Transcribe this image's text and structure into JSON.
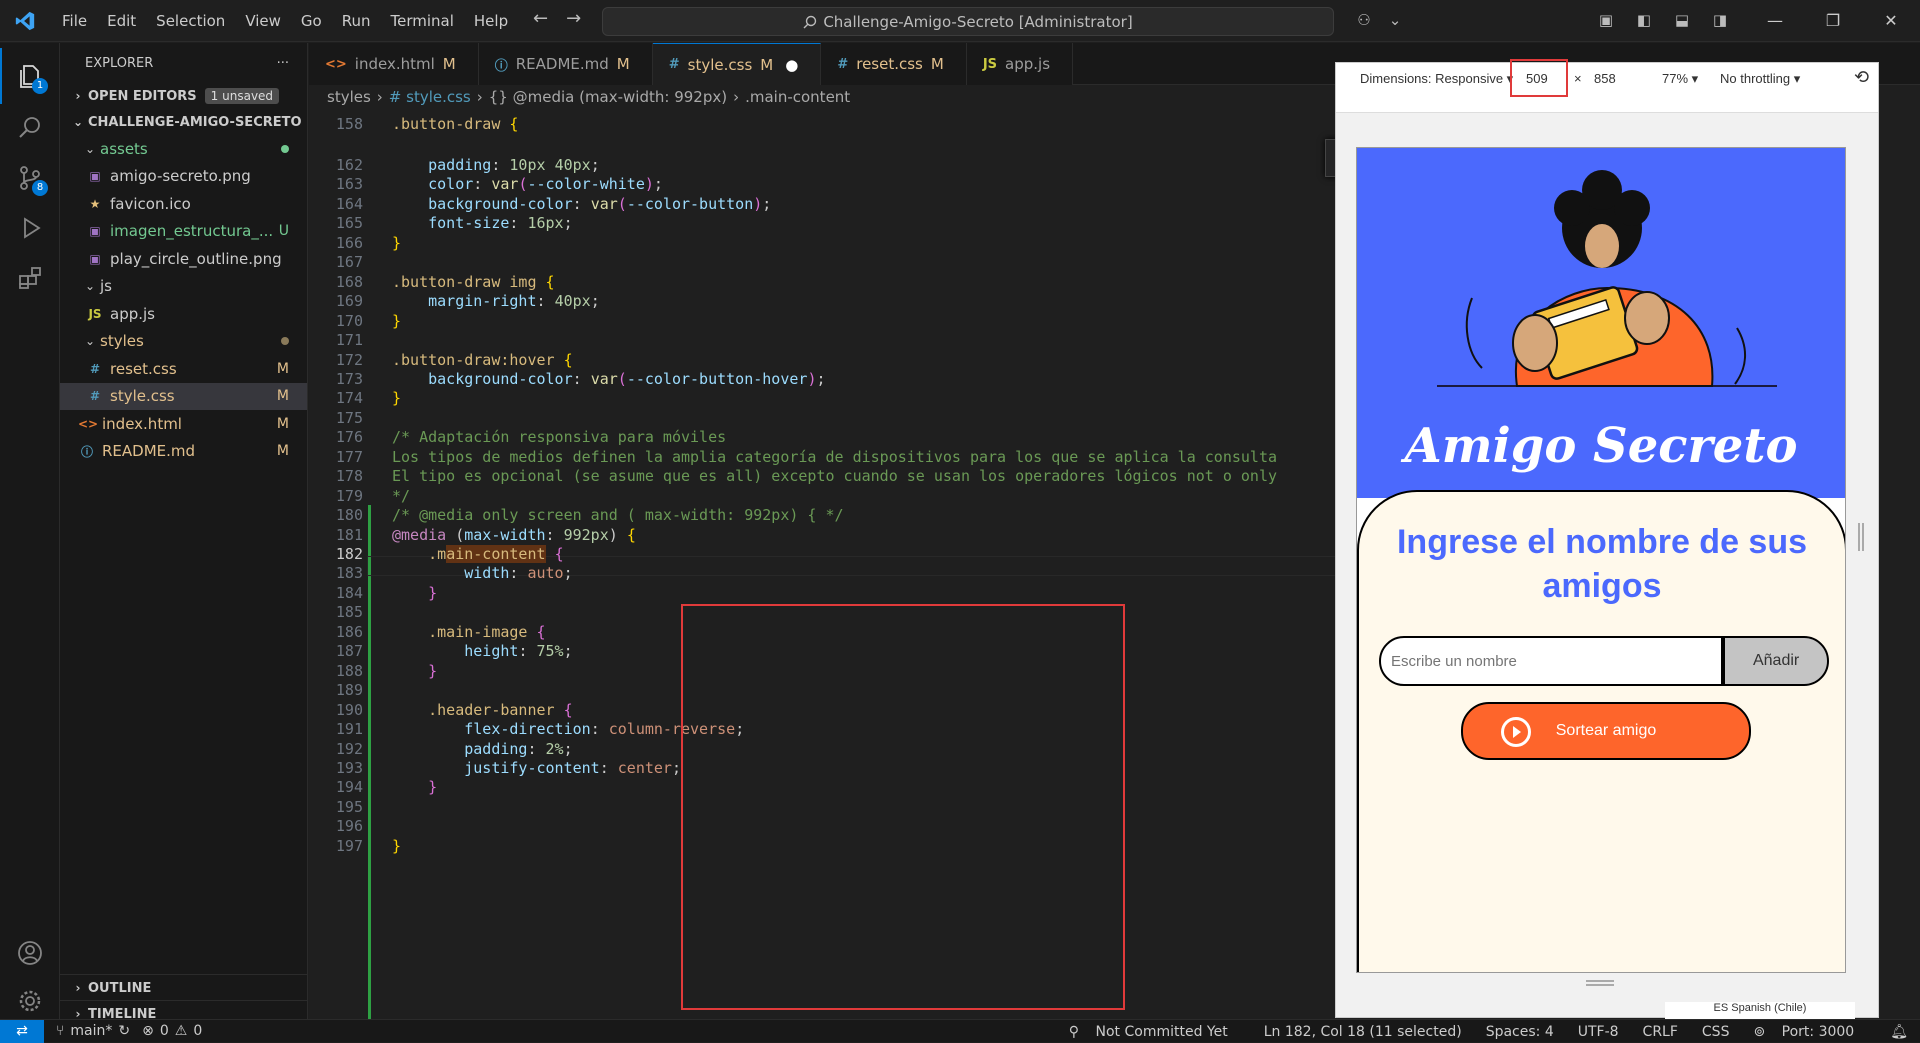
{
  "window": {
    "title": "Challenge-Amigo-Secreto [Administrator]"
  },
  "menu": [
    "File",
    "Edit",
    "Selection",
    "View",
    "Go",
    "Run",
    "Terminal",
    "Help"
  ],
  "activity": {
    "explorer_badge": "1",
    "scm_badge": "8"
  },
  "explorer": {
    "title": "EXPLORER",
    "open_editors": "OPEN EDITORS",
    "unsaved": "1 unsaved",
    "project": "CHALLENGE-AMIGO-SECRETO",
    "items": [
      {
        "name": "assets",
        "status": "",
        "indent": 1,
        "type": "folder"
      },
      {
        "name": "amigo-secreto.png",
        "status": "",
        "indent": 2,
        "type": "img"
      },
      {
        "name": "favicon.ico",
        "status": "",
        "indent": 2,
        "type": "star"
      },
      {
        "name": "imagen_estructura_...",
        "status": "U",
        "indent": 2,
        "type": "img"
      },
      {
        "name": "play_circle_outline.png",
        "status": "",
        "indent": 2,
        "type": "img"
      },
      {
        "name": "js",
        "status": "",
        "indent": 1,
        "type": "folder"
      },
      {
        "name": "app.js",
        "status": "",
        "indent": 2,
        "type": "js"
      },
      {
        "name": "styles",
        "status": "",
        "indent": 1,
        "type": "folder"
      },
      {
        "name": "reset.css",
        "status": "M",
        "indent": 2,
        "type": "css"
      },
      {
        "name": "style.css",
        "status": "M",
        "indent": 2,
        "type": "css"
      },
      {
        "name": "index.html",
        "status": "M",
        "indent": 1,
        "type": "html"
      },
      {
        "name": "README.md",
        "status": "M",
        "indent": 1,
        "type": "info"
      }
    ],
    "outline": "OUTLINE",
    "timeline": "TIMELINE"
  },
  "tabs": [
    {
      "icon": "<>",
      "label": "index.html",
      "mark": "M"
    },
    {
      "icon": "ⓘ",
      "label": "README.md",
      "mark": "M"
    },
    {
      "icon": "#",
      "label": "style.css",
      "mark": "M",
      "active": true
    },
    {
      "icon": "#",
      "label": "reset.css",
      "mark": "M"
    },
    {
      "icon": "JS",
      "label": "app.js",
      "mark": ""
    }
  ],
  "breadcrumbs": [
    "styles",
    "# style.css",
    "{} @media (max-width: 992px)",
    ".main-content"
  ],
  "find_widget": "ain-cont",
  "code": {
    "sticky": {
      "n": "158",
      "text": ".button-draw {"
    },
    "lines": [
      {
        "n": "162",
        "t": "    padding: 10px 40px;"
      },
      {
        "n": "163",
        "t": "    color: var(--color-white);"
      },
      {
        "n": "164",
        "t": "    background-color: var(--color-button);"
      },
      {
        "n": "165",
        "t": "    font-size: 16px;"
      },
      {
        "n": "166",
        "t": "}"
      },
      {
        "n": "167",
        "t": ""
      },
      {
        "n": "168",
        "t": ".button-draw img {"
      },
      {
        "n": "169",
        "t": "    margin-right: 40px;"
      },
      {
        "n": "170",
        "t": "}"
      },
      {
        "n": "171",
        "t": ""
      },
      {
        "n": "172",
        "t": ".button-draw:hover {"
      },
      {
        "n": "173",
        "t": "    background-color: var(--color-button-hover);"
      },
      {
        "n": "174",
        "t": "}"
      },
      {
        "n": "175",
        "t": ""
      },
      {
        "n": "176",
        "t": "/* Adaptación responsiva para móviles"
      },
      {
        "n": "177",
        "t": "Los tipos de medios definen la amplia categoría de dispositivos para los que se aplica la consulta"
      },
      {
        "n": "178",
        "t": "El tipo es opcional (se asume que es all) excepto cuando se usan los operadores lógicos not o only"
      },
      {
        "n": "179",
        "t": "*/"
      },
      {
        "n": "180",
        "t": "/* @media only screen and ( max-width: 992px) { */"
      },
      {
        "n": "181",
        "t": "@media (max-width: 992px) {"
      },
      {
        "n": "182",
        "t": "    .main-content {"
      },
      {
        "n": "183",
        "t": "        width: auto;"
      },
      {
        "n": "184",
        "t": "    }"
      },
      {
        "n": "185",
        "t": ""
      },
      {
        "n": "186",
        "t": "    .main-image {"
      },
      {
        "n": "187",
        "t": "        height: 75%;"
      },
      {
        "n": "188",
        "t": "    }"
      },
      {
        "n": "189",
        "t": ""
      },
      {
        "n": "190",
        "t": "    .header-banner {"
      },
      {
        "n": "191",
        "t": "        flex-direction: column-reverse;"
      },
      {
        "n": "192",
        "t": "        padding: 2%;"
      },
      {
        "n": "193",
        "t": "        justify-content: center;"
      },
      {
        "n": "194",
        "t": "    }"
      },
      {
        "n": "195",
        "t": ""
      },
      {
        "n": "196",
        "t": ""
      },
      {
        "n": "197",
        "t": "}"
      }
    ]
  },
  "devtools": {
    "dimensions": "Dimensions: Responsive ▾",
    "width": "509",
    "x": "×",
    "height": "858",
    "zoom": "77% ▾",
    "throttle": "No throttling ▾",
    "lang": "ES Spanish (Chile)"
  },
  "app": {
    "title": "Amigo Secreto",
    "heading": "Ingrese el nombre de sus amigos",
    "placeholder": "Escribe un nombre",
    "add": "Añadir",
    "draw": "Sortear amigo",
    "colors": {
      "primary": "#4b69fd",
      "accent": "#fe652b",
      "panel": "#fff9eb"
    }
  },
  "status": {
    "branch": "main*",
    "errors": "0",
    "warnings": "0",
    "commit": "Not Committed Yet",
    "position": "Ln 182, Col 18 (11 selected)",
    "spaces": "Spaces: 4",
    "encoding": "UTF-8",
    "eol": "CRLF",
    "lang": "CSS",
    "port": "Port: 3000"
  }
}
